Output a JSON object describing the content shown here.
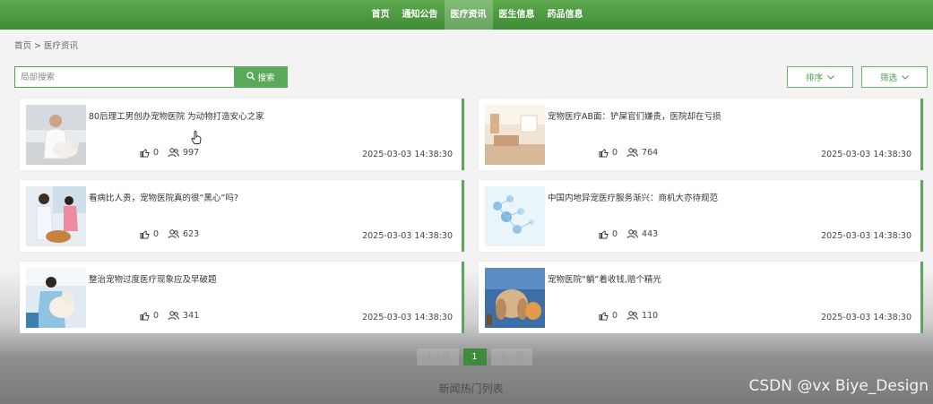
{
  "nav": {
    "items": [
      {
        "label": "首页",
        "active": false
      },
      {
        "label": "通知公告",
        "active": false
      },
      {
        "label": "医疗资讯",
        "active": true
      },
      {
        "label": "医生信息",
        "active": false
      },
      {
        "label": "药品信息",
        "active": false
      }
    ]
  },
  "breadcrumb": {
    "home": "首页",
    "separator": ">",
    "current": "医疗资讯"
  },
  "search": {
    "placeholder": "局部搜索",
    "button_label": "搜索"
  },
  "filters": {
    "sort_label": "排序",
    "screen_label": "筛选"
  },
  "articles": [
    {
      "title": "80后理工男创办宠物医院 为动物打造安心之家",
      "likes": "0",
      "views": "997",
      "time": "2025-03-03 14:38:30"
    },
    {
      "title": "宠物医疗AB面：铲屎官们嫌贵，医院却在亏损",
      "likes": "0",
      "views": "764",
      "time": "2025-03-03 14:38:30"
    },
    {
      "title": "看病比人贵，宠物医院真的很“黑心”吗?",
      "likes": "0",
      "views": "623",
      "time": "2025-03-03 14:38:30"
    },
    {
      "title": "中国内地异宠医疗服务渐兴：商机大亦待规范",
      "likes": "0",
      "views": "443",
      "time": "2025-03-03 14:38:30"
    },
    {
      "title": "整治宠物过度医疗现象应及早破题",
      "likes": "0",
      "views": "341",
      "time": "2025-03-03 14:38:30"
    },
    {
      "title": "宠物医院“躺”着收钱,赔个精光",
      "likes": "0",
      "views": "110",
      "time": "2025-03-03 14:38:30"
    }
  ],
  "pagination": {
    "prev": "上一页",
    "current": "1",
    "next": "下一页"
  },
  "footer": {
    "title": "新闻热门列表"
  },
  "watermark": "CSDN @vx Biye_Design",
  "colors": {
    "primary": "#4e9b43",
    "accent": "#5aa85a"
  }
}
